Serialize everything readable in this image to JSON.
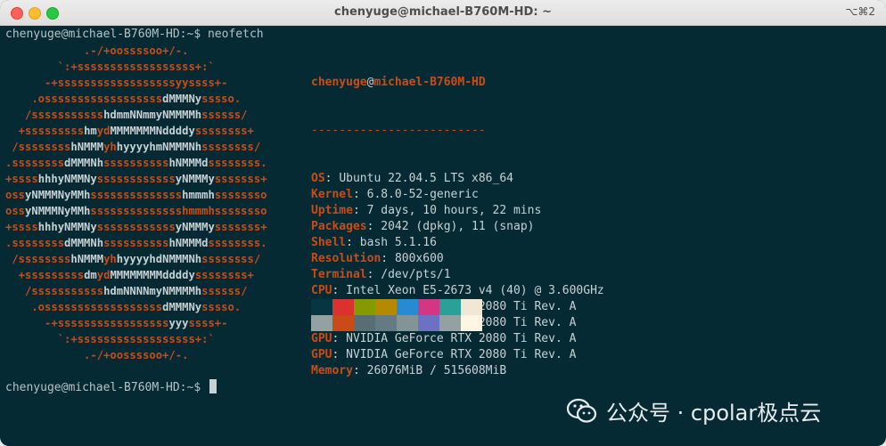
{
  "window": {
    "title": "chenyuge@michael-B760M-HD: ~",
    "shortcut": "⌥⌘2"
  },
  "terminal": {
    "prompt": "chenyuge@michael-B760M-HD:~$ ",
    "command": "neofetch",
    "final_prompt": "chenyuge@michael-B760M-HD:~$ "
  },
  "logo_lines": [
    [
      [
        "o",
        "            .-/+oossssoo+/-."
      ]
    ],
    [
      [
        "o",
        "        `:+ssssssssssssssssss+:`"
      ]
    ],
    [
      [
        "o",
        "      -+ssssssssssssssssssyyssss+-"
      ]
    ],
    [
      [
        "o",
        "    .ossssssssssssssssss"
      ],
      [
        "w",
        "dMMMNy"
      ],
      [
        "o",
        "sssso."
      ]
    ],
    [
      [
        "o",
        "   /sssssssssss"
      ],
      [
        "w",
        "hdmmNNmmyNMMMMh"
      ],
      [
        "o",
        "ssssss/"
      ]
    ],
    [
      [
        "o",
        "  +sssssssss"
      ],
      [
        "w",
        "hm"
      ],
      [
        "o",
        "yd"
      ],
      [
        "w",
        "MMMMMMMNddddy"
      ],
      [
        "o",
        "ssssssss+"
      ]
    ],
    [
      [
        "o",
        " /ssssssss"
      ],
      [
        "w",
        "hNMMM"
      ],
      [
        "o",
        "yh"
      ],
      [
        "w",
        "hyyyyhmNMMMNh"
      ],
      [
        "o",
        "ssssssss/"
      ]
    ],
    [
      [
        "o",
        ".ssssssss"
      ],
      [
        "w",
        "dMMMNh"
      ],
      [
        "o",
        "ssssssssss"
      ],
      [
        "w",
        "hNMMMd"
      ],
      [
        "o",
        "ssssssss."
      ]
    ],
    [
      [
        "o",
        "+ssss"
      ],
      [
        "w",
        "hhhyNMMNy"
      ],
      [
        "o",
        "ssssssssssss"
      ],
      [
        "w",
        "yNMMMy"
      ],
      [
        "o",
        "sssssss+"
      ]
    ],
    [
      [
        "o",
        "oss"
      ],
      [
        "w",
        "yNMMMNyMMh"
      ],
      [
        "o",
        "ssssssssssssss"
      ],
      [
        "w",
        "hmmmh"
      ],
      [
        "o",
        "ssssssso"
      ]
    ],
    [
      [
        "o",
        "oss"
      ],
      [
        "w",
        "yNMMMNyMMh"
      ],
      [
        "o",
        "sssssssssssssshmmmhssssssso"
      ]
    ],
    [
      [
        "o",
        "+ssss"
      ],
      [
        "w",
        "hhhyNMMNy"
      ],
      [
        "o",
        "ssssssssssss"
      ],
      [
        "w",
        "yNMMMy"
      ],
      [
        "o",
        "sssssss+"
      ]
    ],
    [
      [
        "o",
        ".ssssssss"
      ],
      [
        "w",
        "dMMMNh"
      ],
      [
        "o",
        "ssssssssss"
      ],
      [
        "w",
        "hNMMMd"
      ],
      [
        "o",
        "ssssssss."
      ]
    ],
    [
      [
        "o",
        " /ssssssss"
      ],
      [
        "w",
        "hNMMM"
      ],
      [
        "o",
        "yh"
      ],
      [
        "w",
        "hyyyyhdNMMMNh"
      ],
      [
        "o",
        "ssssssss/"
      ]
    ],
    [
      [
        "o",
        "  +sssssssss"
      ],
      [
        "w",
        "dm"
      ],
      [
        "o",
        "yd"
      ],
      [
        "w",
        "MMMMMMMMddddy"
      ],
      [
        "o",
        "ssssssss+"
      ]
    ],
    [
      [
        "o",
        "   /sssssssssss"
      ],
      [
        "w",
        "hdmNNNNmyNMMMMh"
      ],
      [
        "o",
        "ssssss/"
      ]
    ],
    [
      [
        "o",
        "    .ossssssssssssssssss"
      ],
      [
        "w",
        "dMMMNy"
      ],
      [
        "o",
        "sssso."
      ]
    ],
    [
      [
        "o",
        "      -+sssssssssssssssss"
      ],
      [
        "w",
        "yyy"
      ],
      [
        "o",
        "ssss+-"
      ]
    ],
    [
      [
        "o",
        "        `:+ssssssssssssssssss+:`"
      ]
    ],
    [
      [
        "o",
        "            .-/+oossssoo+/-."
      ]
    ]
  ],
  "info": {
    "user": "chenyuge",
    "at": "@",
    "host": "michael-B760M-HD",
    "separator": "-------------------------",
    "rows": [
      {
        "key": "OS",
        "value": "Ubuntu 22.04.5 LTS x86_64"
      },
      {
        "key": "Kernel",
        "value": "6.8.0-52-generic"
      },
      {
        "key": "Uptime",
        "value": "7 days, 10 hours, 22 mins"
      },
      {
        "key": "Packages",
        "value": "2042 (dpkg), 11 (snap)"
      },
      {
        "key": "Shell",
        "value": "bash 5.1.16"
      },
      {
        "key": "Resolution",
        "value": "800x600"
      },
      {
        "key": "Terminal",
        "value": "/dev/pts/1"
      },
      {
        "key": "CPU",
        "value": "Intel Xeon E5-2673 v4 (40) @ 3.600GHz"
      },
      {
        "key": "GPU",
        "value": "NVIDIA GeForce RTX 2080 Ti Rev. A"
      },
      {
        "key": "GPU",
        "value": "NVIDIA GeForce RTX 2080 Ti Rev. A"
      },
      {
        "key": "GPU",
        "value": "NVIDIA GeForce RTX 2080 Ti Rev. A"
      },
      {
        "key": "GPU",
        "value": "NVIDIA GeForce RTX 2080 Ti Rev. A"
      },
      {
        "key": "Memory",
        "value": "26076MiB / 515608MiB"
      }
    ]
  },
  "palette": {
    "row1": [
      "#073642",
      "#dc322f",
      "#859900",
      "#b58900",
      "#268bd2",
      "#d33682",
      "#2aa198",
      "#eee8d5"
    ],
    "row2": [
      "#93a1a1",
      "#cb4b16",
      "#586e75",
      "#657b83",
      "#839496",
      "#6c71c4",
      "#93a1a1",
      "#fdf6e3"
    ]
  },
  "watermark": {
    "icon": "wechat-icon",
    "text": "公众号 · cpolar极点云"
  }
}
